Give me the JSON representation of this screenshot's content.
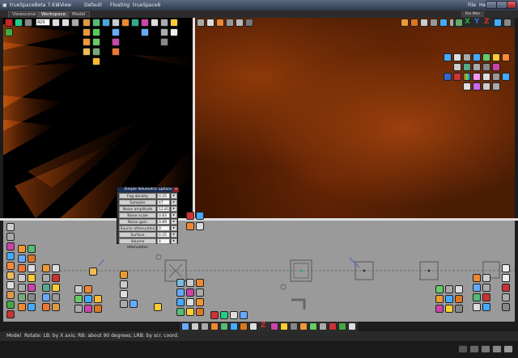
{
  "window": {
    "title": "trueSpaceBeta 7.61",
    "menus": [
      {
        "label": "4View"
      },
      {
        "label": "Default"
      },
      {
        "label": "Floating"
      },
      {
        "label": "trueSpace6"
      }
    ],
    "file_label": "File",
    "help_label": "Help",
    "file_menu_badge": "File Men"
  },
  "tabs": [
    {
      "label": "Viewscene"
    },
    {
      "label": "Workspace"
    },
    {
      "label": "Model"
    }
  ],
  "frame_counter": "420",
  "volumetric_panel": {
    "title": "Simple Volumetric options",
    "rows": [
      {
        "label": "Fog density",
        "value": "0.25"
      },
      {
        "label": "Samples",
        "value": "47"
      },
      {
        "label": "Noise amplitude",
        "value": "12.81"
      },
      {
        "label": "Noise scale",
        "value": "0.83"
      },
      {
        "label": "Noise gain",
        "value": "0.89"
      },
      {
        "label": "Source attenuation",
        "value": "0"
      },
      {
        "label": "Surface attenuation",
        "value": "0.25"
      },
      {
        "label": "Volume attenuation",
        "value": "4"
      }
    ]
  },
  "status": {
    "mode": "Model",
    "hint": "Rotate: LB: by X axis; RB: about 90 degrees; LRB: by scr. coord."
  },
  "colors": {
    "fog_orange": "#b4500f",
    "bottom_view_bg": "#9a9a9a",
    "divider": "#e0e0e0",
    "title_bar": "#2e3a4c",
    "accent_red": "#cc2222",
    "accent_blue": "#2255cc",
    "accent_green": "#22aa44"
  }
}
